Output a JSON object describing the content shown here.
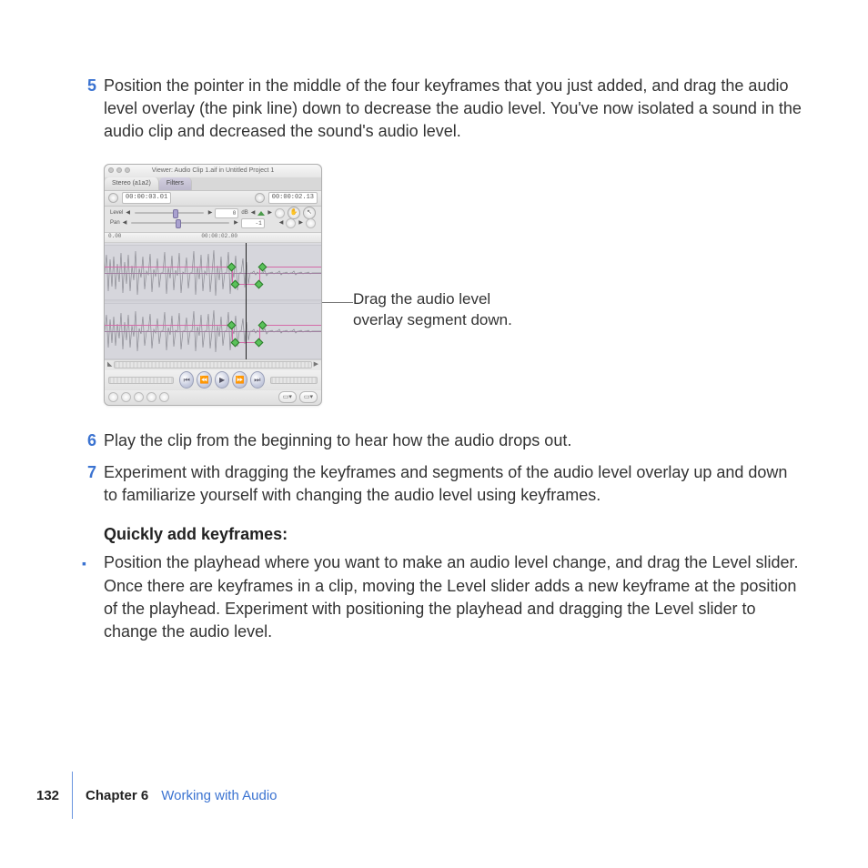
{
  "steps": {
    "s5": {
      "num": "5",
      "text": "Position the pointer in the middle of the four keyframes that you just added, and drag the audio level overlay (the pink line) down to decrease the audio level. You've now isolated a sound in the audio clip and decreased the sound's audio level."
    },
    "s6": {
      "num": "6",
      "text": "Play the clip from the beginning to hear how the audio drops out."
    },
    "s7": {
      "num": "7",
      "text": "Experiment with dragging the keyframes and segments of the audio level overlay up and down to familiarize yourself with changing the audio level using keyframes."
    }
  },
  "subhead": "Quickly add keyframes:",
  "bullet1": "Position the playhead where you want to make an audio level change, and drag the Level slider. Once there are keyframes in a clip, moving the Level slider adds a new keyframe at the position of the playhead. Experiment with positioning the playhead and dragging the Level slider to change the audio level.",
  "callout": {
    "line1": "Drag the audio level",
    "line2": "overlay segment down."
  },
  "viewer": {
    "title": "Viewer: Audio Clip 1.aif in Untitled Project 1",
    "tab_active": "Stereo (a1a2)",
    "tab_inactive": "Filters",
    "tc_left": "00:00:03.01",
    "tc_right": "00:00:02.13",
    "level_label": "Level",
    "level_value": "0",
    "level_unit": "dB",
    "pan_label": "Pan",
    "pan_value": "-1",
    "ruler_start": "0.00",
    "ruler_mid": "00:00:02.00"
  },
  "footer": {
    "page": "132",
    "chapter": "Chapter 6",
    "title": "Working with Audio"
  }
}
